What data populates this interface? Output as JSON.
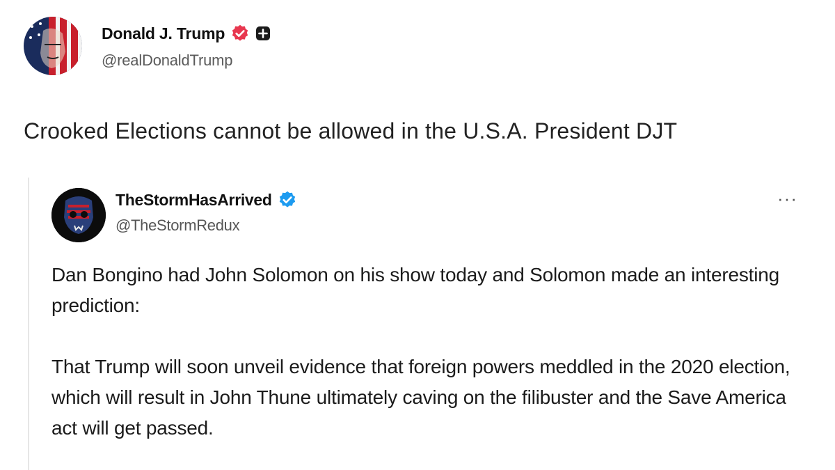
{
  "post": {
    "author": {
      "display_name": "Donald J. Trump",
      "handle": "@realDonaldTrump",
      "verified_badge_color": "#e8374f"
    },
    "text": "Crooked Elections cannot be allowed in the U.S.A. President DJT"
  },
  "quoted_post": {
    "author": {
      "display_name": "TheStormHasArrived",
      "handle": "@TheStormRedux",
      "verified_badge_color": "#1d9bf0"
    },
    "more_label": "···",
    "paragraphs": [
      "Dan Bongino had John Solomon on his show today and Solomon made an interesting prediction:",
      "That Trump will soon unveil evidence that foreign powers meddled in the 2020 election, which will result in John Thune ultimately caving on the filibuster and the Save America act will get passed."
    ]
  },
  "icons": {
    "verified": "verified-badge-icon",
    "subscriber": "plus-icon",
    "more": "more-horizontal-icon"
  }
}
